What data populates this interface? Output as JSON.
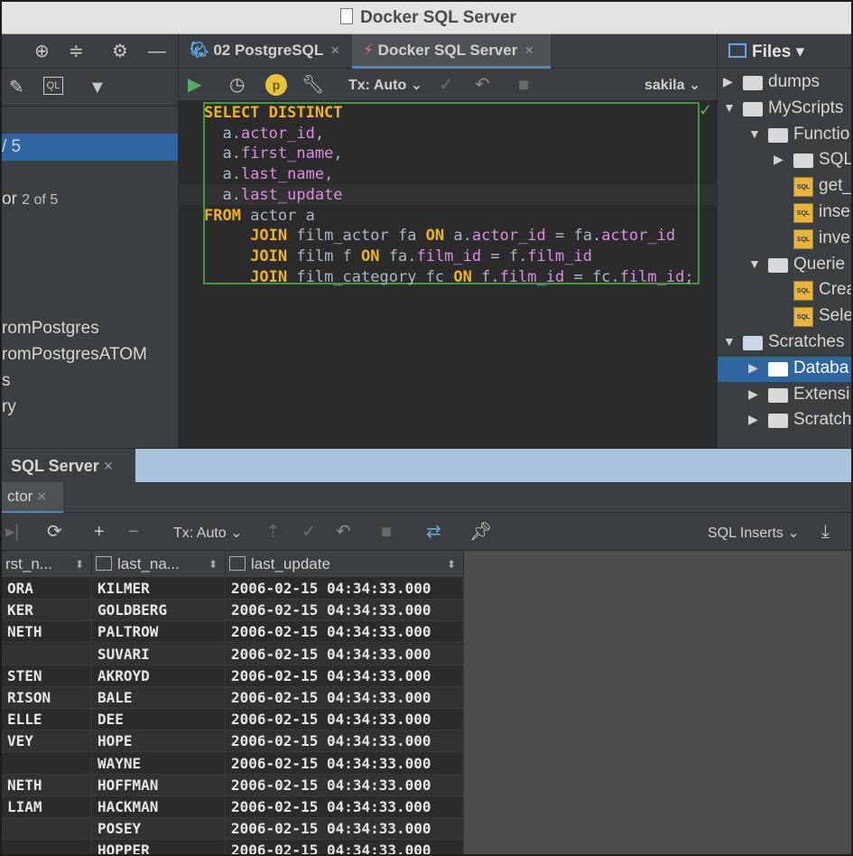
{
  "window": {
    "title": "Docker SQL Server"
  },
  "left_panel": {
    "items": [
      {
        "text": "/ 5"
      },
      {
        "text": "or",
        "sub": "2 of 5"
      },
      {
        "text": "romPostgres"
      },
      {
        "text": "romPostgresATOM"
      },
      {
        "text": "s"
      },
      {
        "text": "ry"
      }
    ]
  },
  "editor_tabs": [
    {
      "label": "02 PostgreSQL",
      "close": "×"
    },
    {
      "label": "Docker SQL Server",
      "close": "×"
    }
  ],
  "editor_toolbar": {
    "tx_mode": "Tx: Auto",
    "schema": "sakila"
  },
  "sql_lines": [
    [
      {
        "t": "SELECT DISTINCT",
        "k": "kw"
      }
    ],
    [
      {
        "t": "  a.",
        "k": ""
      },
      {
        "t": "actor_id",
        "k": "col"
      },
      {
        "t": ",",
        "k": ""
      }
    ],
    [
      {
        "t": "  a.",
        "k": ""
      },
      {
        "t": "first_name",
        "k": "col"
      },
      {
        "t": ",",
        "k": ""
      }
    ],
    [
      {
        "t": "  a.",
        "k": ""
      },
      {
        "t": "last_name",
        "k": "col"
      },
      {
        "t": ",",
        "k": ""
      }
    ],
    [
      {
        "t": "  a.",
        "k": ""
      },
      {
        "t": "last_update",
        "k": "col"
      }
    ],
    [
      {
        "t": "FROM",
        "k": "kw"
      },
      {
        "t": " actor a",
        "k": ""
      }
    ],
    [
      {
        "t": "     ",
        "k": ""
      },
      {
        "t": "JOIN",
        "k": "kw"
      },
      {
        "t": " film_actor fa ",
        "k": ""
      },
      {
        "t": "ON",
        "k": "kw"
      },
      {
        "t": " a.",
        "k": ""
      },
      {
        "t": "actor_id",
        "k": "col"
      },
      {
        "t": " = fa.",
        "k": ""
      },
      {
        "t": "actor_id",
        "k": "col"
      }
    ],
    [
      {
        "t": "     ",
        "k": ""
      },
      {
        "t": "JOIN",
        "k": "kw"
      },
      {
        "t": " film f ",
        "k": ""
      },
      {
        "t": "ON",
        "k": "kw"
      },
      {
        "t": " fa.",
        "k": ""
      },
      {
        "t": "film_id",
        "k": "col"
      },
      {
        "t": " = f.",
        "k": ""
      },
      {
        "t": "film_id",
        "k": "col"
      }
    ],
    [
      {
        "t": "     ",
        "k": ""
      },
      {
        "t": "JOIN",
        "k": "kw"
      },
      {
        "t": " film_category fc ",
        "k": ""
      },
      {
        "t": "ON",
        "k": "kw"
      },
      {
        "t": " f.",
        "k": ""
      },
      {
        "t": "film_id",
        "k": "col"
      },
      {
        "t": " = fc.",
        "k": ""
      },
      {
        "t": "film_id",
        "k": "col"
      },
      {
        "t": ";",
        "k": ""
      }
    ]
  ],
  "files_panel": {
    "header": "Files",
    "rows": [
      {
        "label": "dumps",
        "kind": "folder",
        "arrow": "right",
        "depth": 0
      },
      {
        "label": "MyScripts",
        "kind": "folder",
        "arrow": "down",
        "depth": 0
      },
      {
        "label": "Functio",
        "kind": "folder",
        "arrow": "down",
        "depth": 1
      },
      {
        "label": "SQL",
        "kind": "folder",
        "arrow": "right",
        "depth": 2
      },
      {
        "label": "get_",
        "kind": "sql",
        "arrow": "",
        "depth": 2
      },
      {
        "label": "inse",
        "kind": "sql",
        "arrow": "",
        "depth": 2
      },
      {
        "label": "inve",
        "kind": "sql",
        "arrow": "",
        "depth": 2
      },
      {
        "label": "Querie",
        "kind": "folder",
        "arrow": "down",
        "depth": 1
      },
      {
        "label": "Crea",
        "kind": "sql",
        "arrow": "",
        "depth": 2
      },
      {
        "label": "Sele",
        "kind": "sql",
        "arrow": "",
        "depth": 2
      },
      {
        "label": "Scratches",
        "kind": "scratch",
        "arrow": "down",
        "depth": 0
      },
      {
        "label": "Databa",
        "kind": "folder",
        "arrow": "right",
        "depth": 1,
        "selected": true
      },
      {
        "label": "Extensi",
        "kind": "folder",
        "arrow": "right",
        "depth": 1
      },
      {
        "label": "Scratch",
        "kind": "folder",
        "arrow": "right",
        "depth": 1
      }
    ]
  },
  "bottom": {
    "tab": "SQL Server",
    "tab_close": "×",
    "subtab": "ctor",
    "subtab_close": "×",
    "tx_mode": "Tx: Auto",
    "export": "SQL Inserts"
  },
  "result_grid": {
    "columns": [
      "rst_n...",
      "last_na...",
      "last_update"
    ],
    "rows": [
      [
        "ORA",
        "KILMER",
        "2006-02-15 04:34:33.000"
      ],
      [
        "KER",
        "GOLDBERG",
        "2006-02-15 04:34:33.000"
      ],
      [
        "NETH",
        "PALTROW",
        "2006-02-15 04:34:33.000"
      ],
      [
        "",
        "SUVARI",
        "2006-02-15 04:34:33.000"
      ],
      [
        "STEN",
        "AKROYD",
        "2006-02-15 04:34:33.000"
      ],
      [
        "RISON",
        "BALE",
        "2006-02-15 04:34:33.000"
      ],
      [
        "ELLE",
        "DEE",
        "2006-02-15 04:34:33.000"
      ],
      [
        "VEY",
        "HOPE",
        "2006-02-15 04:34:33.000"
      ],
      [
        "",
        "WAYNE",
        "2006-02-15 04:34:33.000"
      ],
      [
        "NETH",
        "HOFFMAN",
        "2006-02-15 04:34:33.000"
      ],
      [
        "LIAM",
        "HACKMAN",
        "2006-02-15 04:34:33.000"
      ],
      [
        "",
        "POSEY",
        "2006-02-15 04:34:33.000"
      ],
      [
        "",
        "HOPPER",
        "2006-02-15 04:34:33.000"
      ]
    ]
  }
}
